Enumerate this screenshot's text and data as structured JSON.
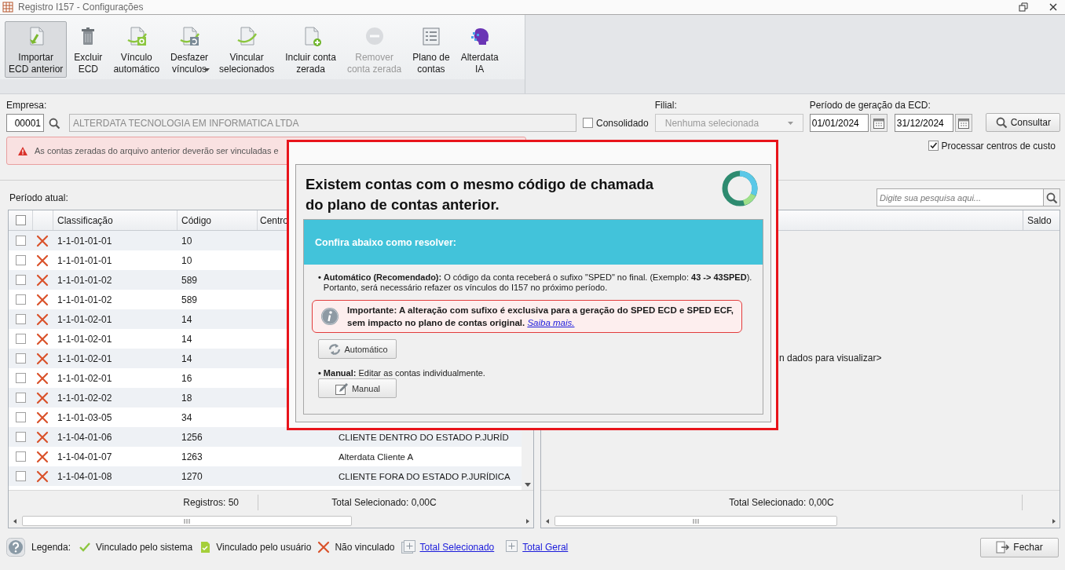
{
  "window": {
    "title": "Registro I157 - Configurações"
  },
  "toolbar": [
    {
      "label": "Importar\nECD anterior",
      "selected": true,
      "disabled": false
    },
    {
      "label": "Excluir\nECD",
      "selected": false,
      "disabled": false
    },
    {
      "label": "Vínculo\nautomático",
      "selected": false,
      "disabled": false
    },
    {
      "label": "Desfazer\nvínculos",
      "selected": false,
      "disabled": false,
      "dropdown": true
    },
    {
      "label": "Vincular\nselecionados",
      "selected": false,
      "disabled": false
    },
    {
      "label": "Incluir conta\nzerada",
      "selected": false,
      "disabled": false
    },
    {
      "label": "Remover\nconta zerada",
      "selected": false,
      "disabled": true
    },
    {
      "label": "Plano de\ncontas",
      "selected": false,
      "disabled": false
    },
    {
      "label": "Alterdata\nIA",
      "selected": false,
      "disabled": false
    }
  ],
  "form": {
    "empresa_label": "Empresa:",
    "empresa_code": "00001",
    "empresa_name": "ALTERDATA TECNOLOGIA EM INFORMATICA LTDA",
    "consolidado": {
      "label": "Consolidado",
      "checked": false
    },
    "filial_label": "Filial:",
    "filial_value": "Nenhuma selecionada",
    "periodo_label": "Período de geração da ECD:",
    "start_date": "01/01/2024",
    "end_date": "31/12/2024",
    "consultar": "Consultar"
  },
  "alert": "As contas zeradas do arquivo anterior deverão ser vinculadas e",
  "processar_centros": {
    "label": "Processar centros de custo",
    "checked": true
  },
  "periodo_atual": "Período atual:",
  "search": {
    "placeholder": "Digite sua pesquisa aqui..."
  },
  "left_table": {
    "header_checked": false,
    "columns": [
      "Classificação",
      "Código",
      "Centro"
    ],
    "rows": [
      {
        "checked": false,
        "kind": "not_linked",
        "classification": "1-1-01-01-01",
        "code": "10"
      },
      {
        "checked": false,
        "kind": "not_linked",
        "classification": "1-1-01-01-01",
        "code": "10"
      },
      {
        "checked": false,
        "kind": "not_linked",
        "classification": "1-1-01-01-02",
        "code": "589"
      },
      {
        "checked": false,
        "kind": "not_linked",
        "classification": "1-1-01-01-02",
        "code": "589"
      },
      {
        "checked": false,
        "kind": "not_linked",
        "classification": "1-1-01-02-01",
        "code": "14"
      },
      {
        "checked": false,
        "kind": "not_linked",
        "classification": "1-1-01-02-01",
        "code": "14"
      },
      {
        "checked": false,
        "kind": "not_linked",
        "classification": "1-1-01-02-01",
        "code": "14"
      },
      {
        "checked": false,
        "kind": "not_linked",
        "classification": "1-1-01-02-01",
        "code": "16"
      },
      {
        "checked": false,
        "kind": "not_linked",
        "classification": "1-1-01-02-02",
        "code": "18"
      },
      {
        "checked": false,
        "kind": "not_linked",
        "classification": "1-1-01-03-05",
        "code": "34"
      },
      {
        "checked": false,
        "kind": "not_linked",
        "classification": "1-1-04-01-06",
        "code": "1256",
        "column_4": "CLIENTE DENTRO DO ESTADO P.JURÍD"
      },
      {
        "checked": false,
        "kind": "not_linked",
        "classification": "1-1-04-01-07",
        "code": "1263",
        "column_4": "Alterdata Cliente A"
      },
      {
        "checked": false,
        "kind": "not_linked",
        "classification": "1-1-04-01-08",
        "code": "1270",
        "column_4": "CLIENTE FORA DO ESTADO P.JURÍDICA"
      }
    ],
    "records": "Registros: 50",
    "total": "Total Selecionado: 0,00C"
  },
  "right_table": {
    "columns": [
      "Saldo"
    ],
    "empty_message": "n dados para visualizar>",
    "total": "Total Selecionado: 0,00C"
  },
  "legend": {
    "label": "Legenda:",
    "items": [
      {
        "kind": "system",
        "label": "Vinculado pelo sistema"
      },
      {
        "kind": "user",
        "label": "Vinculado pelo usuário"
      },
      {
        "kind": "not_linked",
        "label": "Não vinculado"
      }
    ],
    "links": [
      "Total Selecionado",
      "Total Geral"
    ],
    "close": "Fechar"
  },
  "dialog": {
    "title": "Existem contas com o mesmo código de chamada do plano de contas anterior.",
    "banner": "Confira abaixo como resolver:",
    "options": [
      {
        "bullet": "•",
        "text": "**Automático (Recomendado):** O código da conta receberá o sufixo \"SPED\" no final. (Exemplo: **43 -> 43SPED**). Portanto, será necessário refazer os vínculos do I157 no próximo período.",
        "note": {
          "text": "Importante: A alteração com sufixo é exclusiva para a geração do SPED ECD e SPED ECF, sem impacto no plano de contas original.",
          "link": "Saiba mais."
        },
        "button": "Automático",
        "kind": "auto"
      },
      {
        "bullet": "•",
        "text": "**Manual:** Editar as contas individualmente.",
        "button": "Manual",
        "kind": "manual"
      }
    ]
  }
}
